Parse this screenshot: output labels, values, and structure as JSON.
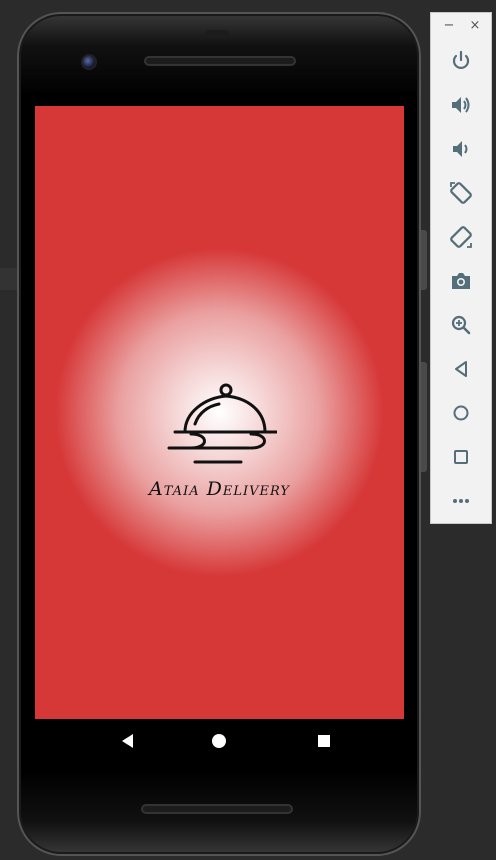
{
  "app": {
    "brand_name": "Ataia Delivery"
  },
  "toolbar": {
    "minimize_label": "−",
    "close_label": "×",
    "more_label": "•••",
    "buttons": [
      {
        "name": "power-icon"
      },
      {
        "name": "volume-up-icon"
      },
      {
        "name": "volume-down-icon"
      },
      {
        "name": "rotate-left-icon"
      },
      {
        "name": "rotate-right-icon"
      },
      {
        "name": "camera-icon"
      },
      {
        "name": "zoom-icon"
      },
      {
        "name": "back-icon"
      },
      {
        "name": "home-icon"
      },
      {
        "name": "overview-icon"
      },
      {
        "name": "more-icon"
      }
    ]
  },
  "navbar": {
    "buttons": [
      "back",
      "home",
      "recents"
    ]
  },
  "colors": {
    "screen_red": "#d63737",
    "toolbar_bg": "#f2f2f2",
    "toolbar_icon": "#546e7a"
  }
}
